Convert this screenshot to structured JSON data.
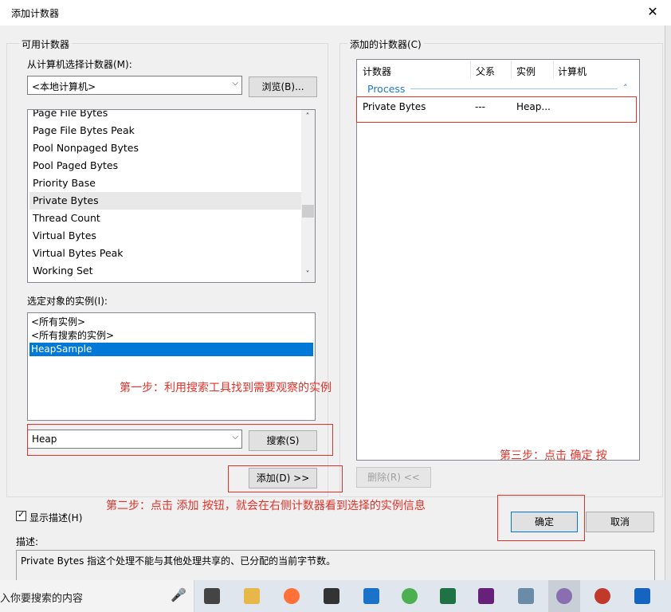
{
  "window": {
    "title": "添加计数器",
    "close_glyph": "✕"
  },
  "available": {
    "group_label": "可用计数器",
    "select_label": "从计算机选择计数器(M):",
    "computer_value": "<本地计算机>",
    "browse_label": "浏览(B)...",
    "counters": [
      "Page File Bytes",
      "Page File Bytes Peak",
      "Pool Nonpaged Bytes",
      "Pool Paged Bytes",
      "Priority Base",
      "Private Bytes",
      "Thread Count",
      "Virtual Bytes",
      "Virtual Bytes Peak",
      "Working Set"
    ],
    "selected_counter": "Private Bytes",
    "instances_label": "选定对象的实例(I):",
    "instances": [
      "<所有实例>",
      "<所有搜索的实例>",
      "HeapSample"
    ],
    "selected_instance": "HeapSample",
    "search_value": "Heap",
    "search_label": "搜索(S)",
    "add_label": "添加(D) >>"
  },
  "added": {
    "group_label": "添加的计数器(C)",
    "columns": [
      "计数器",
      "父系",
      "实例",
      "计算机"
    ],
    "group_name": "Process",
    "rows": [
      {
        "counter": "Private Bytes",
        "parent": "---",
        "instance": "Heap...",
        "computer": ""
      }
    ],
    "remove_label": "删除(R) <<"
  },
  "show_desc": {
    "label": "显示描述(H)",
    "checked": true
  },
  "description": {
    "label": "描述:",
    "text": "Private Bytes 指这个处理不能与其他处理共享的、已分配的当前字节数。"
  },
  "ok_label": "确定",
  "cancel_label": "取消",
  "annotations": {
    "step1": "第一步：利用搜索工具找到需要观察的实例",
    "step2": "第二步：点击 添加 按钮，就会在右侧计数器看到选择的实例信息",
    "step3": "第三步：点击 确定 按"
  },
  "taskbar": {
    "search_placeholder": "入你要搜索的内容",
    "icons": [
      "mic-icon",
      "task-view-icon",
      "file-explorer-icon",
      "firefox-icon",
      "mail-icon",
      "app-icon",
      "chrome-icon",
      "excel-icon",
      "visual-studio-icon",
      "package-icon",
      "user-app-icon",
      "perfmon-icon",
      "window-icon"
    ]
  },
  "colors": {
    "accent": "#0078d7",
    "annotation": "#e0322a",
    "group_header": "#1e78c8"
  }
}
